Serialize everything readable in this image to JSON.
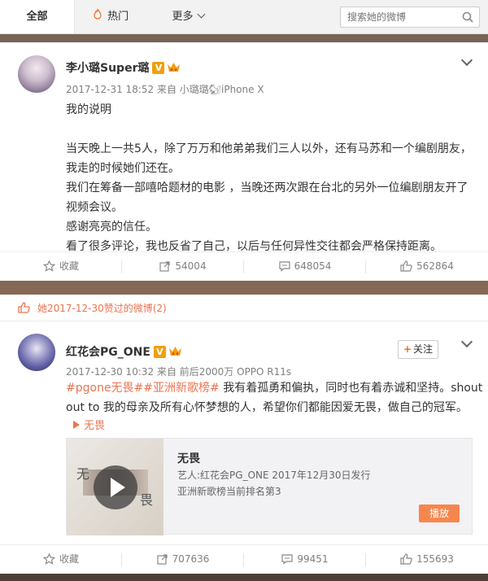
{
  "tabs": {
    "all": "全部",
    "hot": "热门",
    "more": "更多"
  },
  "search": {
    "placeholder": "搜索她的微博"
  },
  "post1": {
    "author": "李小璐Super璐",
    "meta": "2017-12-31 18:52 来自 小璐璐🐿iPhone X",
    "lines": [
      "我的说明",
      "",
      "当天晚上一共5人，除了万万和他弟弟我们三人以外，还有马苏和一个编剧朋友，",
      "我走的时候她们还在。",
      "我们在筹备一部嘻哈题材的电影 ，当晚还两次跟在台北的另外一位编剧朋友开了",
      "视频会议。",
      "感谢亮亮的信任。",
      "看了很多评论，我也反省了自己，以后与任何异性交往都会严格保持距离。"
    ],
    "actions": {
      "favorite": "收藏",
      "repost": "54004",
      "comment": "648054",
      "like": "562864"
    }
  },
  "liked_strip": "她2017-12-30赞过的微博(2)",
  "post2": {
    "author": "红花会PG_ONE",
    "meta": "2017-12-30 10:32 来自 前后2000万 OPPO R11s",
    "follow": "关注",
    "hashtags": "#pgone无畏##亚洲新歌榜#",
    "line1_rest": " 我有着孤勇和偏执，同时也有着赤诚和坚持。shout",
    "line2": "out to 我的母亲及所有心怀梦想的人，希望你们都能因爱无畏，做自己的冠军。",
    "link": "无畏",
    "media": {
      "cover_char1": "无",
      "cover_char2": "畏",
      "title": "无畏",
      "info1": "艺人:红花会PG_ONE 2017年12月30日发行",
      "info2": "亚洲新歌榜当前排名第3",
      "play": "播放"
    },
    "actions": {
      "favorite": "收藏",
      "repost": "707636",
      "comment": "99451",
      "like": "155693"
    }
  },
  "colors": {
    "accent": "#eb7350",
    "vip": "#f0a010",
    "play_button": "#f7864e"
  }
}
